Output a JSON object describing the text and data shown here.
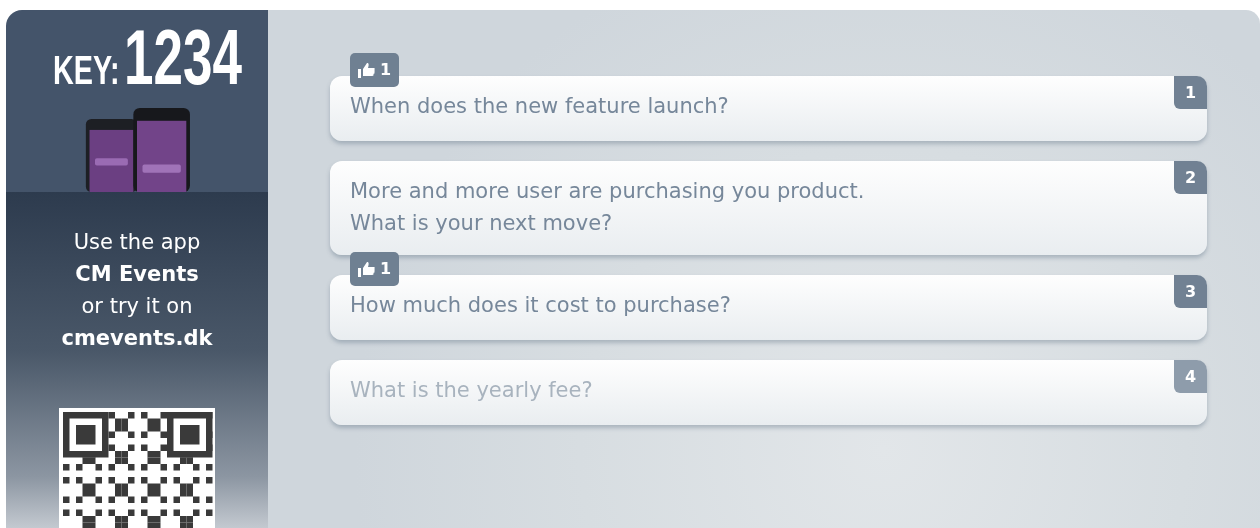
{
  "sidebar": {
    "key_label": "KEY:",
    "key_value": "1234",
    "instructions": [
      {
        "text": "Use the app",
        "bold": false
      },
      {
        "text": "CM Events",
        "bold": true
      },
      {
        "text": "or try it on",
        "bold": false
      },
      {
        "text": "cmevents.dk",
        "bold": true
      }
    ]
  },
  "questions": [
    {
      "number": "1",
      "likes": "1",
      "text": "When does the new feature launch?",
      "faded": false
    },
    {
      "number": "2",
      "text": "More and more user are purchasing you product.\nWhat is your next move?",
      "faded": false
    },
    {
      "number": "3",
      "likes": "1",
      "text": "How much does it cost to purchase?",
      "faded": false
    },
    {
      "number": "4",
      "text": "What is the yearly fee?",
      "faded": true
    }
  ]
}
